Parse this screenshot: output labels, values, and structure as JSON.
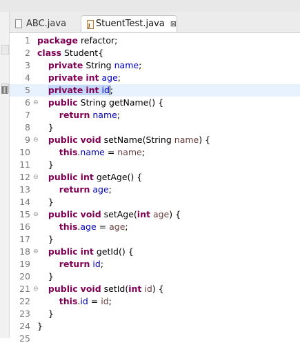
{
  "tabs": [
    {
      "label": "ABC.java"
    },
    {
      "label": "StuentTest.java",
      "close": "⊠"
    }
  ],
  "fold_glyph": "⊖",
  "editor": {
    "lines": [
      {
        "n": "1",
        "tokens": [
          {
            "t": "package",
            "c": "kw"
          },
          {
            "t": " refactor;"
          }
        ]
      },
      {
        "n": "2",
        "tokens": [
          {
            "t": "class",
            "c": "kw"
          },
          {
            "t": " Student{"
          }
        ]
      },
      {
        "n": "3",
        "tokens": [
          {
            "t": "    "
          },
          {
            "t": "private",
            "c": "kw"
          },
          {
            "t": " String "
          },
          {
            "t": "name",
            "c": "fld"
          },
          {
            "t": ";"
          }
        ]
      },
      {
        "n": "4",
        "tokens": [
          {
            "t": "    "
          },
          {
            "t": "private",
            "c": "kw"
          },
          {
            "t": " "
          },
          {
            "t": "int",
            "c": "kw"
          },
          {
            "t": " "
          },
          {
            "t": "age",
            "c": "fld"
          },
          {
            "t": ";"
          }
        ]
      },
      {
        "n": "5",
        "current": true,
        "marker": true,
        "tokens": [
          {
            "t": "    "
          },
          {
            "t": "private",
            "c": "kw sel"
          },
          {
            "t": " ",
            "c": "sel"
          },
          {
            "t": "int",
            "c": "kw sel"
          },
          {
            "t": " ",
            "c": "sel"
          },
          {
            "t": "id",
            "c": "fld sel"
          },
          {
            "caret": true
          },
          {
            "t": ";"
          }
        ]
      },
      {
        "n": "6",
        "fold": true,
        "tokens": [
          {
            "t": "    "
          },
          {
            "t": "public",
            "c": "kw"
          },
          {
            "t": " String getName() {"
          }
        ]
      },
      {
        "n": "7",
        "tokens": [
          {
            "t": "        "
          },
          {
            "t": "return",
            "c": "kw"
          },
          {
            "t": " "
          },
          {
            "t": "name",
            "c": "fld"
          },
          {
            "t": ";"
          }
        ]
      },
      {
        "n": "8",
        "tokens": [
          {
            "t": "    }"
          }
        ]
      },
      {
        "n": "9",
        "fold": true,
        "tokens": [
          {
            "t": "    "
          },
          {
            "t": "public",
            "c": "kw"
          },
          {
            "t": " "
          },
          {
            "t": "void",
            "c": "kw"
          },
          {
            "t": " setName(String "
          },
          {
            "t": "name",
            "c": "prm"
          },
          {
            "t": ") {"
          }
        ]
      },
      {
        "n": "10",
        "tokens": [
          {
            "t": "        "
          },
          {
            "t": "this",
            "c": "kw"
          },
          {
            "t": "."
          },
          {
            "t": "name",
            "c": "fld"
          },
          {
            "t": " = "
          },
          {
            "t": "name",
            "c": "prm"
          },
          {
            "t": ";"
          }
        ]
      },
      {
        "n": "11",
        "tokens": [
          {
            "t": "    }"
          }
        ]
      },
      {
        "n": "12",
        "fold": true,
        "tokens": [
          {
            "t": "    "
          },
          {
            "t": "public",
            "c": "kw"
          },
          {
            "t": " "
          },
          {
            "t": "int",
            "c": "kw"
          },
          {
            "t": " getAge() {"
          }
        ]
      },
      {
        "n": "13",
        "tokens": [
          {
            "t": "        "
          },
          {
            "t": "return",
            "c": "kw"
          },
          {
            "t": " "
          },
          {
            "t": "age",
            "c": "fld"
          },
          {
            "t": ";"
          }
        ]
      },
      {
        "n": "14",
        "tokens": [
          {
            "t": "    }"
          }
        ]
      },
      {
        "n": "15",
        "fold": true,
        "tokens": [
          {
            "t": "    "
          },
          {
            "t": "public",
            "c": "kw"
          },
          {
            "t": " "
          },
          {
            "t": "void",
            "c": "kw"
          },
          {
            "t": " setAge("
          },
          {
            "t": "int",
            "c": "kw"
          },
          {
            "t": " "
          },
          {
            "t": "age",
            "c": "prm"
          },
          {
            "t": ") {"
          }
        ]
      },
      {
        "n": "16",
        "tokens": [
          {
            "t": "        "
          },
          {
            "t": "this",
            "c": "kw"
          },
          {
            "t": "."
          },
          {
            "t": "age",
            "c": "fld"
          },
          {
            "t": " = "
          },
          {
            "t": "age",
            "c": "prm"
          },
          {
            "t": ";"
          }
        ]
      },
      {
        "n": "17",
        "tokens": [
          {
            "t": "    }"
          }
        ]
      },
      {
        "n": "18",
        "fold": true,
        "tokens": [
          {
            "t": "    "
          },
          {
            "t": "public",
            "c": "kw"
          },
          {
            "t": " "
          },
          {
            "t": "int",
            "c": "kw"
          },
          {
            "t": " getId() {"
          }
        ]
      },
      {
        "n": "19",
        "tokens": [
          {
            "t": "        "
          },
          {
            "t": "return",
            "c": "kw"
          },
          {
            "t": " "
          },
          {
            "t": "id",
            "c": "fld"
          },
          {
            "t": ";"
          }
        ]
      },
      {
        "n": "20",
        "tokens": [
          {
            "t": "    }"
          }
        ]
      },
      {
        "n": "21",
        "fold": true,
        "tokens": [
          {
            "t": "    "
          },
          {
            "t": "public",
            "c": "kw"
          },
          {
            "t": " "
          },
          {
            "t": "void",
            "c": "kw"
          },
          {
            "t": " setId("
          },
          {
            "t": "int",
            "c": "kw"
          },
          {
            "t": " "
          },
          {
            "t": "id",
            "c": "prm"
          },
          {
            "t": ") {"
          }
        ]
      },
      {
        "n": "22",
        "tokens": [
          {
            "t": "        "
          },
          {
            "t": "this",
            "c": "kw"
          },
          {
            "t": "."
          },
          {
            "t": "id",
            "c": "fld"
          },
          {
            "t": " = "
          },
          {
            "t": "id",
            "c": "prm"
          },
          {
            "t": ";"
          }
        ]
      },
      {
        "n": "23",
        "tokens": [
          {
            "t": "    }"
          }
        ]
      },
      {
        "n": "24",
        "tokens": [
          {
            "t": "}"
          }
        ]
      },
      {
        "n": "25",
        "tokens": []
      }
    ]
  }
}
